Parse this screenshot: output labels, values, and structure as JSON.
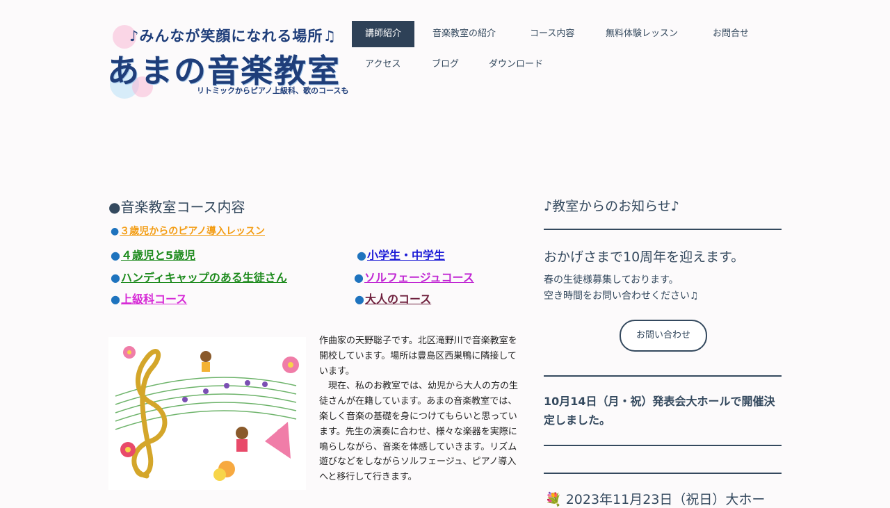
{
  "logo": {
    "tagline": "♪みんなが笑顔になれる場所♫",
    "title": "あまの音楽教室",
    "subtitle": "リトミックからピアノ上級科、歌のコースも"
  },
  "nav": {
    "items": [
      {
        "label": "講師紹介",
        "active": true
      },
      {
        "label": "音楽教室の紹介"
      },
      {
        "label": "コース内容"
      },
      {
        "label": "無料体験レッスン"
      },
      {
        "label": "お問合せ"
      },
      {
        "label": "アクセス"
      },
      {
        "label": "ブログ"
      },
      {
        "label": "ダウンロード"
      }
    ]
  },
  "main": {
    "section_title": "●音楽教室コース内容",
    "courses": [
      {
        "label": "３歳児からのピアノ導入レッスン",
        "color": "#f39c12"
      },
      {
        "label": "４歳児と5歳児",
        "color": "#1e8b1e"
      },
      {
        "label": "小学生・中学生",
        "color": "#1a1ad6"
      },
      {
        "label": "ハンディキャップのある生徒さん",
        "color": "#1e8b1e"
      },
      {
        "label": "ソルフェージュコース",
        "color": "#c026d3"
      },
      {
        "label": "上級科コース",
        "color": "#d62ad6"
      },
      {
        "label": "大人のコース",
        "color": "#6e1f3c"
      }
    ],
    "intro": "作曲家の天野聡子です。北区滝野川で音楽教室を開校しています。場所は豊島区西巣鴨に隣接しています。\n　現在、私のお教室では、幼児から大人の方の生徒さんが在籍しています。あまの音楽教室では、楽しく音楽の基礎を身につけてもらいと思っています。先生の演奏に合わせ、様々な楽器を実際に鳴らしながら、音楽を体感していきます。リズム遊びなどをしながらソルフェージュ、ピアノ導入へと移行して行きます。"
  },
  "sidebar": {
    "title": "♪教室からのお知らせ♪",
    "news_head": "おかげさまで10周年を迎えます。",
    "news_body": "春の生徒様募集しております。\n空き時間をお問い合わせください♫",
    "contact_label": "お問い合わせ",
    "event1": "10月14日（月・祝）発表会大ホールで開催決定しました。",
    "event2": "💐 2023年11月23日（祝日）大ホー"
  },
  "colors": {
    "navy": "#34495e",
    "nav_active": "#2e4157",
    "bullet": "#1e73be",
    "logo": "#1f3e7a"
  }
}
